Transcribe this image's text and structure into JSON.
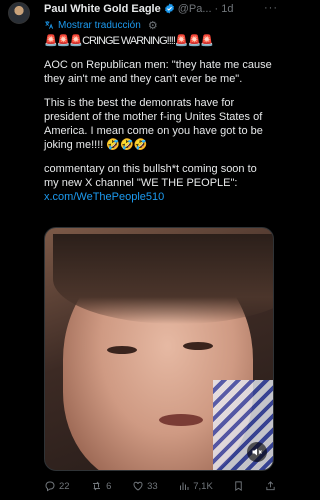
{
  "author": {
    "name": "Paul White Gold Eagle",
    "handle": "@Pa...",
    "time": "· 1d"
  },
  "translate": {
    "label": "Mostrar traducción"
  },
  "post": {
    "line1": "🚨🚨🚨CRINGE WARNING!!!!🚨🚨🚨",
    "para2": "AOC on Republican men: \"they hate me cause they ain't me and they can't ever be me\".",
    "para3": "This is the best the demonrats have for president of the mother f-ing Unites States of America. I mean come on you have got to be joking me!!!! 🤣🤣🤣",
    "para4_text": "commentary on this bullsh*t coming soon to my new X channel \"WE THE PEOPLE\": ",
    "para4_link": "x.com/WeThePeople510"
  },
  "actions": {
    "replies": "22",
    "reposts": "6",
    "likes": "33",
    "views": "7,1K"
  },
  "colors": {
    "background": "#000000",
    "accent": "#1d9bf0",
    "muted": "#71767b"
  },
  "icons": [
    "verified-badge-icon",
    "more-icon",
    "gear-icon",
    "reply-icon",
    "repost-icon",
    "like-icon",
    "views-icon",
    "bookmark-icon",
    "share-icon",
    "mute-icon"
  ]
}
